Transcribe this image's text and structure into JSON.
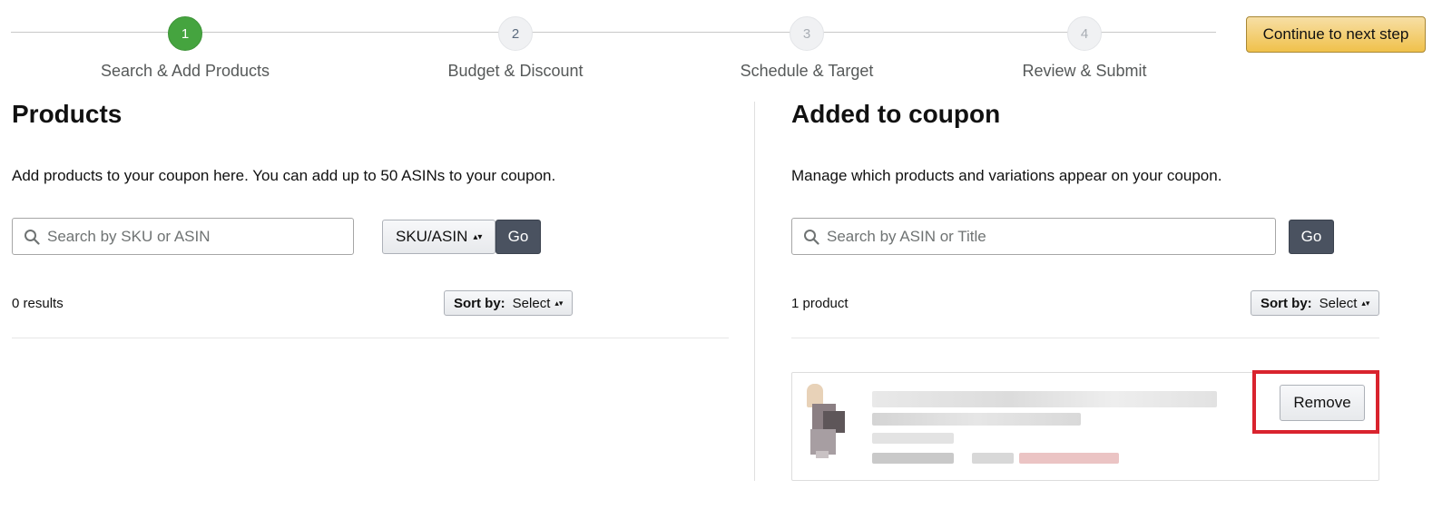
{
  "stepper": {
    "steps": [
      {
        "number": "1",
        "label": "Search & Add Products"
      },
      {
        "number": "2",
        "label": "Budget & Discount"
      },
      {
        "number": "3",
        "label": "Schedule & Target"
      },
      {
        "number": "4",
        "label": "Review & Submit"
      }
    ],
    "continue_label": "Continue to next step"
  },
  "products_panel": {
    "title": "Products",
    "description": "Add products to your coupon here. You can add up to 50 ASINs to your coupon.",
    "search_placeholder": "Search by SKU or ASIN",
    "search_type": "SKU/ASIN",
    "go_label": "Go",
    "results_count": "0 results",
    "sort_label": "Sort by:",
    "sort_value": "Select"
  },
  "coupon_panel": {
    "title": "Added to coupon",
    "description": "Manage which products and variations appear on your coupon.",
    "search_placeholder": "Search by ASIN or Title",
    "go_label": "Go",
    "product_count": "1 product",
    "sort_label": "Sort by:",
    "sort_value": "Select",
    "remove_label": "Remove"
  },
  "colors": {
    "active_step": "#45a43f",
    "primary_button": "#f0c14b",
    "go_button": "#4a5260",
    "highlight": "#d9232e"
  }
}
